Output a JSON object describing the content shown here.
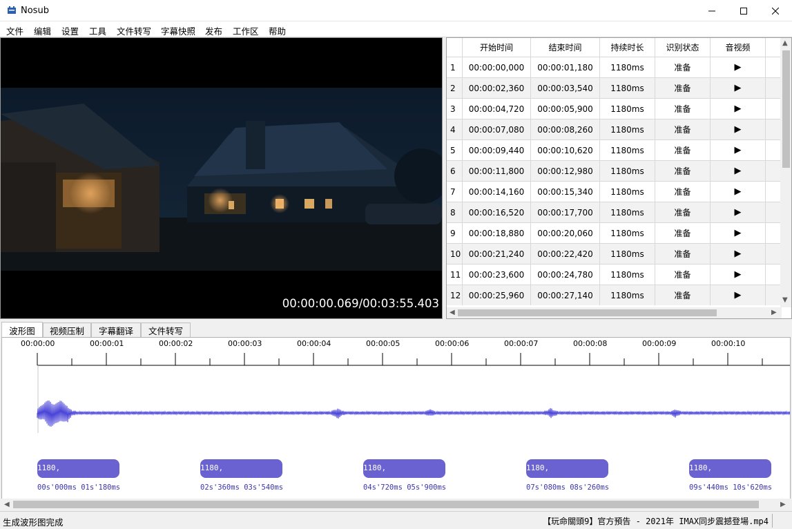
{
  "window": {
    "title": "Nosub"
  },
  "menu": [
    "文件",
    "编辑",
    "设置",
    "工具",
    "文件转写",
    "字幕快照",
    "发布",
    "工作区",
    "帮助"
  ],
  "video": {
    "timecode": "00:00:00.069/00:03:55.403"
  },
  "grid": {
    "columns": [
      "",
      "开始时间",
      "结束时间",
      "持续时长",
      "识别状态",
      "音视频"
    ],
    "rows": [
      {
        "n": "1",
        "start": "00:00:00,000",
        "end": "00:00:01,180",
        "dur": "1180ms",
        "status": "准备",
        "play": "▶"
      },
      {
        "n": "2",
        "start": "00:00:02,360",
        "end": "00:00:03,540",
        "dur": "1180ms",
        "status": "准备",
        "play": "▶"
      },
      {
        "n": "3",
        "start": "00:00:04,720",
        "end": "00:00:05,900",
        "dur": "1180ms",
        "status": "准备",
        "play": "▶"
      },
      {
        "n": "4",
        "start": "00:00:07,080",
        "end": "00:00:08,260",
        "dur": "1180ms",
        "status": "准备",
        "play": "▶"
      },
      {
        "n": "5",
        "start": "00:00:09,440",
        "end": "00:00:10,620",
        "dur": "1180ms",
        "status": "准备",
        "play": "▶"
      },
      {
        "n": "6",
        "start": "00:00:11,800",
        "end": "00:00:12,980",
        "dur": "1180ms",
        "status": "准备",
        "play": "▶"
      },
      {
        "n": "7",
        "start": "00:00:14,160",
        "end": "00:00:15,340",
        "dur": "1180ms",
        "status": "准备",
        "play": "▶"
      },
      {
        "n": "8",
        "start": "00:00:16,520",
        "end": "00:00:17,700",
        "dur": "1180ms",
        "status": "准备",
        "play": "▶"
      },
      {
        "n": "9",
        "start": "00:00:18,880",
        "end": "00:00:20,060",
        "dur": "1180ms",
        "status": "准备",
        "play": "▶"
      },
      {
        "n": "10",
        "start": "00:00:21,240",
        "end": "00:00:22,420",
        "dur": "1180ms",
        "status": "准备",
        "play": "▶"
      },
      {
        "n": "11",
        "start": "00:00:23,600",
        "end": "00:00:24,780",
        "dur": "1180ms",
        "status": "准备",
        "play": "▶"
      },
      {
        "n": "12",
        "start": "00:00:25,960",
        "end": "00:00:27,140",
        "dur": "1180ms",
        "status": "准备",
        "play": "▶"
      }
    ]
  },
  "tabs": [
    "波形图",
    "视频压制",
    "字幕翻译",
    "文件转写"
  ],
  "waveform": {
    "ruler_labels": [
      "00:00:00",
      "00:00:01",
      "00:00:02",
      "00:00:03",
      "00:00:04",
      "00:00:05",
      "00:00:06",
      "00:00:07",
      "00:00:08",
      "00:00:09",
      "00:00:10"
    ],
    "segments": [
      {
        "label": "1180,",
        "times": "00s'000ms  01s'180ms"
      },
      {
        "label": "1180,",
        "times": "02s'360ms  03s'540ms"
      },
      {
        "label": "1180,",
        "times": "04s'720ms  05s'900ms"
      },
      {
        "label": "1180,",
        "times": "07s'080ms  08s'260ms"
      },
      {
        "label": "1180,",
        "times": "09s'440ms  10s'620ms"
      }
    ],
    "wave_color": "#4a44d8",
    "segment_color": "#6a62d0"
  },
  "status": {
    "left": "生成波形图完成",
    "file": "【玩命關頭9】官方預告 - 2021年 IMAX同步震撼登場.mp4"
  }
}
